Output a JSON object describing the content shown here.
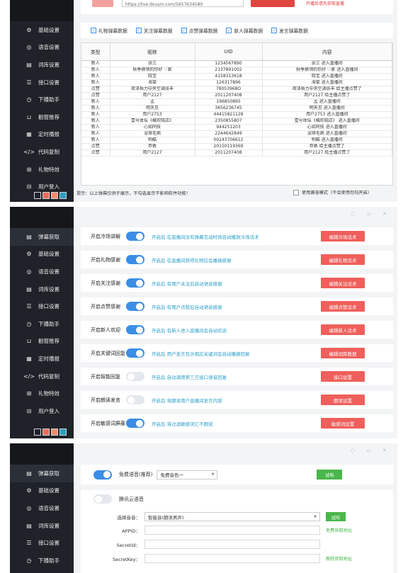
{
  "sidebar_a": {
    "items": [
      {
        "label": "基础设置",
        "icon": "gear-icon",
        "glyph": "⚙"
      },
      {
        "label": "语音设置",
        "icon": "speaker-icon",
        "glyph": "◎"
      },
      {
        "label": "词库设置",
        "icon": "database-icon",
        "glyph": "▤"
      },
      {
        "label": "接口设置",
        "icon": "sliders-icon",
        "glyph": "☰"
      },
      {
        "label": "下播助手",
        "icon": "clock-icon",
        "glyph": "◷"
      },
      {
        "label": "橱窗推荐",
        "icon": "cart-icon",
        "glyph": "⊔"
      },
      {
        "label": "定时播报",
        "icon": "calendar-icon",
        "glyph": "▦"
      },
      {
        "label": "代码复制",
        "icon": "code-icon",
        "glyph": "</>"
      },
      {
        "label": "礼物特效",
        "icon": "gift-icon",
        "glyph": "⊞"
      },
      {
        "label": "用户登入",
        "icon": "login-icon",
        "glyph": "⊟"
      }
    ]
  },
  "sidebar_b": {
    "items": [
      {
        "label": "弹幕获取",
        "icon": "list-icon",
        "glyph": "▤"
      },
      {
        "label": "基础设置",
        "icon": "gear-icon",
        "glyph": "⚙"
      },
      {
        "label": "语音设置",
        "icon": "speaker-icon",
        "glyph": "◎"
      },
      {
        "label": "词库设置",
        "icon": "database-icon",
        "glyph": "▤"
      },
      {
        "label": "接口设置",
        "icon": "sliders-icon",
        "glyph": "☰"
      },
      {
        "label": "下播助手",
        "icon": "clock-icon",
        "glyph": "◷"
      },
      {
        "label": "橱窗推荐",
        "icon": "cart-icon",
        "glyph": "⊔"
      },
      {
        "label": "定时播报",
        "icon": "calendar-icon",
        "glyph": "▦"
      },
      {
        "label": "代码复制",
        "icon": "code-icon",
        "glyph": "</>"
      },
      {
        "label": "礼物特效",
        "icon": "gift-icon",
        "glyph": "⊞"
      },
      {
        "label": "用户登入",
        "icon": "login-icon",
        "glyph": "⊟"
      }
    ]
  },
  "sidebar_c": {
    "items": [
      {
        "label": "弹幕获取",
        "icon": "list-icon",
        "glyph": "▤"
      },
      {
        "label": "基础设置",
        "icon": "gear-icon",
        "glyph": "⚙"
      },
      {
        "label": "语音设置",
        "icon": "speaker-icon",
        "glyph": "◎"
      },
      {
        "label": "词库设置",
        "icon": "database-icon",
        "glyph": "▤"
      },
      {
        "label": "接口设置",
        "icon": "sliders-icon",
        "glyph": "☰"
      },
      {
        "label": "下播助手",
        "icon": "clock-icon",
        "glyph": "◷"
      }
    ]
  },
  "theme_colors": [
    "#1f2329",
    "#ef6b5b",
    "#f08c6c",
    "#2a9fc0"
  ],
  "window_controls": "○ ▭ ✕",
  "panel1": {
    "url_value": "https://live.douyin.com/5657634580",
    "warning": "开播后请先获取直播",
    "checkboxes": [
      "礼物弹幕数据",
      "关注弹幕数据",
      "点赞弹幕数据",
      "新人弹幕数据",
      "发言弹幕数据"
    ],
    "table_headers": [
      "类型",
      "昵称",
      "UID",
      "内容"
    ],
    "rows": [
      [
        "新人",
        "张三",
        "1234567890",
        "张三 进入直播间"
      ],
      [
        "新人",
        "秋季换领的你好 ♡家",
        "2137891002",
        "秋季换领的你好 ♡家 进入直播间"
      ],
      [
        "新人",
        "晓宝",
        "4158313618",
        "晓宝 进入直播间"
      ],
      [
        "新人",
        "海棠",
        "126317896",
        "海棠 进入直播间"
      ],
      [
        "点赞",
        "荷泽梧力中央空调张丰",
        "78053968O",
        "荷泽梧力中央空调张丰 给主播点赞了"
      ],
      [
        "点赞",
        "用户2127",
        "2011207408",
        "用户2127 给主播点赞了"
      ],
      [
        "新人",
        "孟",
        "196850895",
        "孟 进入直播间"
      ],
      [
        "新人",
        "明天见",
        "3656236745",
        "明天见 进入直播间"
      ],
      [
        "新人",
        "用户2753",
        "44415821128",
        "用户2753 进入直播间"
      ],
      [
        "新人",
        "壹号体坛《橘欢晓店》",
        "2350855807",
        "壹号体坛《橘欢晓店》 进入直播间"
      ],
      [
        "新人",
        "心如同技",
        "944251203",
        "心如同技 进入直播间"
      ],
      [
        "新人",
        "没得毛病",
        "2244642849",
        "没得毛病 进入直播间"
      ],
      [
        "新人",
        "哟酷",
        "00243706612",
        "哟酷 进入直播间"
      ],
      [
        "点赞",
        "恭敦",
        "20150119369",
        "恭敦 给主播点赞了"
      ],
      [
        "点赞",
        "用户2127",
        "2011207408",
        "用户2127 给主播点赞了"
      ]
    ],
    "footnote": "提示：以上弹幕仅供于展示，不勾选显示不影响软件功能！",
    "compat_label": "使用兼容模式（不会使用勿勾开启）"
  },
  "panel2": {
    "rows": [
      {
        "label": "开启冷场讲解",
        "on": true,
        "desc": "开启后 在直播间没有弹幕互动时将自动播放冷场话术",
        "button": "编辑冷场话术"
      },
      {
        "label": "开启礼物感谢",
        "on": true,
        "desc": "开启后 在直播间获得礼物后会播报感谢",
        "button": "编辑礼物话术"
      },
      {
        "label": "开启关注感谢",
        "on": true,
        "desc": "开启后 有用户关注后自动语音感谢",
        "button": "编辑关注话术"
      },
      {
        "label": "开启点赞感谢",
        "on": true,
        "desc": "开启后 有用户点赞后自动语音感谢",
        "button": "编辑点赞话术"
      },
      {
        "label": "开启新人欢迎",
        "on": true,
        "desc": "开启后 有新人进入直播间会自动欢迎",
        "button": "编辑新人话术"
      },
      {
        "label": "开启关键词回复",
        "on": true,
        "desc": "开启后 用户发言包含相应关键词会自动播报回复",
        "button": "编辑词库数据"
      },
      {
        "label": "开启智能回复",
        "on": false,
        "desc": "开启后 自动调用第三方接口语音回复",
        "button": "接口设置"
      },
      {
        "label": "开启朗读发言",
        "on": false,
        "desc": "开启后 将朗读用户直播间发言内容",
        "button": "朗读设置"
      },
      {
        "label": "开启敏感词屏蔽",
        "on": true,
        "desc": "开启后 将过滤敏感词汇不朗读",
        "button": "敏感词设置"
      }
    ]
  },
  "panel3": {
    "tts_label": "免费语音(推荐)",
    "tts_voice": "免费音色一",
    "listen_label": "试听",
    "cloud_label": "腾讯云语音",
    "voice_label": "选择音音：",
    "voice_value": "智能音(朗读男声)",
    "listen2_label": "试听",
    "appid_label": "APPID：",
    "appid_link": "免费获取地址",
    "secretid_label": "SecretId：",
    "secretkey_label": "SecretKey：",
    "secretkey_link": "教程获取地址"
  }
}
